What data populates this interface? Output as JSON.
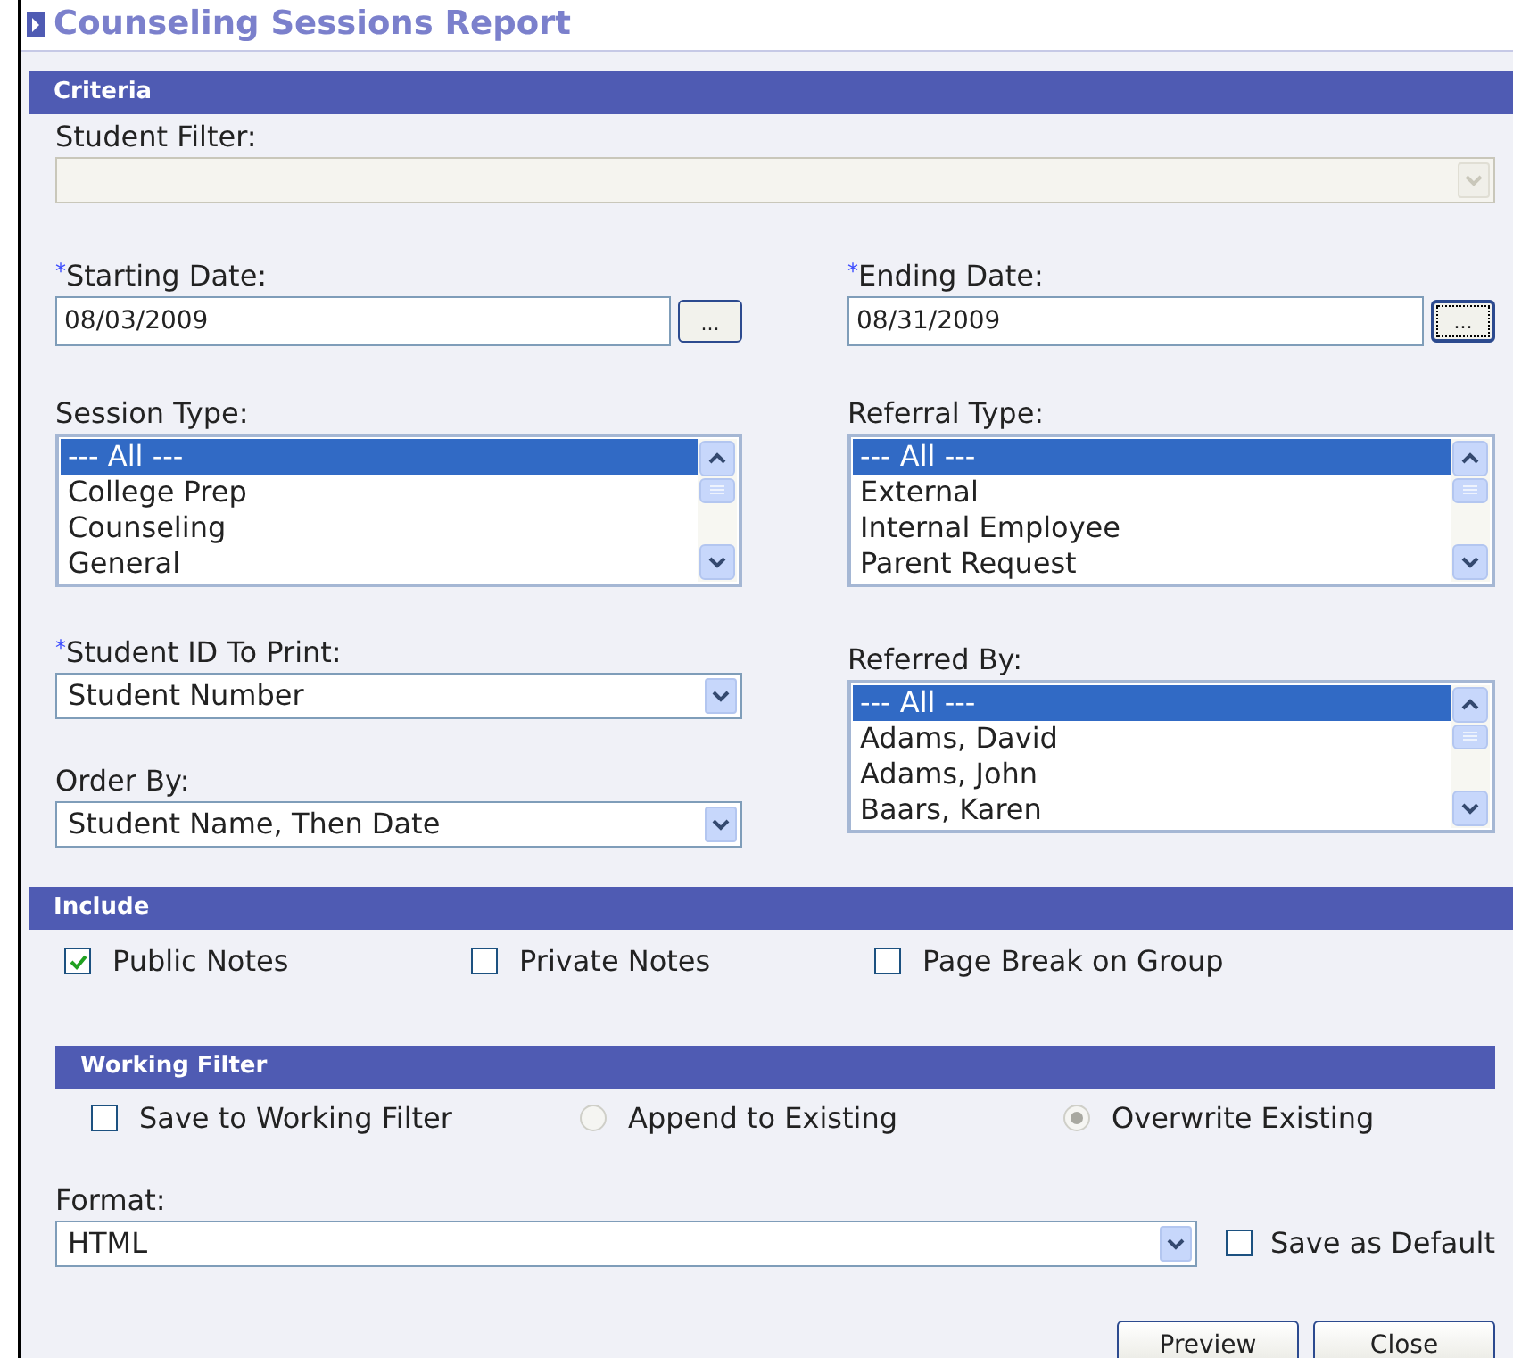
{
  "title": "Counseling Sessions Report",
  "criteria": {
    "header": "Criteria",
    "student_filter": {
      "label": "Student Filter:",
      "disabled": true
    },
    "starting_date": {
      "required_mark": "*",
      "label": "Starting Date:",
      "value": "08/03/2009",
      "button": "...",
      "focused": false
    },
    "ending_date": {
      "required_mark": "*",
      "label": "Ending Date:",
      "value": "08/31/2009",
      "button": "...",
      "focused": true
    },
    "session_type": {
      "label": "Session Type:",
      "items": [
        {
          "label": "--- All ---",
          "selected": true
        },
        {
          "label": "College Prep",
          "selected": false
        },
        {
          "label": "Counseling",
          "selected": false
        },
        {
          "label": "General",
          "selected": false
        }
      ]
    },
    "referral_type": {
      "label": "Referral Type:",
      "items": [
        {
          "label": "--- All ---",
          "selected": true
        },
        {
          "label": "External",
          "selected": false
        },
        {
          "label": "Internal Employee",
          "selected": false
        },
        {
          "label": "Parent Request",
          "selected": false
        }
      ]
    },
    "student_id_to_print": {
      "required_mark": "*",
      "label": "Student ID To Print:",
      "value": "Student Number"
    },
    "order_by": {
      "label": "Order By:",
      "value": "Student Name, Then Date"
    },
    "referred_by": {
      "label": "Referred By:",
      "items": [
        {
          "label": "--- All ---",
          "selected": true
        },
        {
          "label": "Adams, David",
          "selected": false
        },
        {
          "label": "Adams, John",
          "selected": false
        },
        {
          "label": "Baars, Karen",
          "selected": false
        }
      ]
    }
  },
  "include": {
    "header": "Include",
    "options": [
      {
        "label": "Public Notes",
        "checked": true
      },
      {
        "label": "Private Notes",
        "checked": false
      },
      {
        "label": "Page Break on Group",
        "checked": false
      }
    ]
  },
  "working_filter": {
    "header": "Working Filter",
    "options": [
      {
        "kind": "checkbox",
        "label": "Save to Working Filter",
        "checked": false,
        "disabled": false
      },
      {
        "kind": "radio",
        "label": "Append to Existing",
        "selected": false,
        "disabled": true
      },
      {
        "kind": "radio",
        "label": "Overwrite Existing",
        "selected": true,
        "disabled": true
      }
    ]
  },
  "format": {
    "label": "Format:",
    "value": "HTML"
  },
  "save_as_default": {
    "label": "Save as Default",
    "checked": false
  },
  "buttons": [
    "Preview",
    "Close"
  ]
}
